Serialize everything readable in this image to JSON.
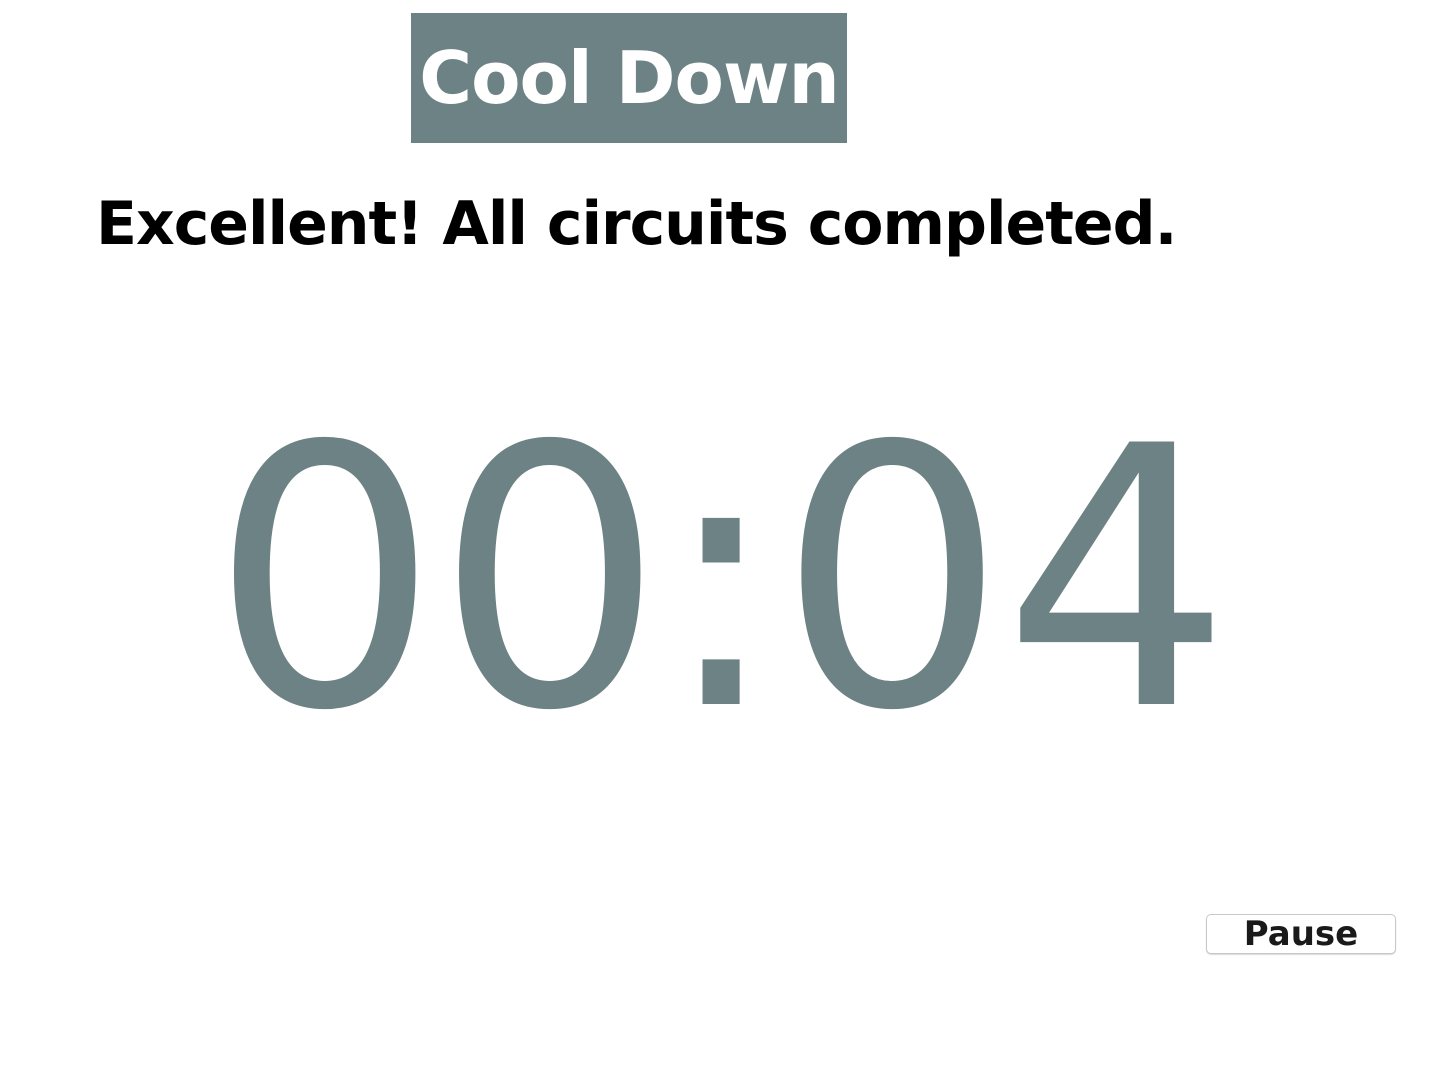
{
  "phase": {
    "title": "Cool Down",
    "color": "#6d8284"
  },
  "status": {
    "message": "Excellent! All circuits completed."
  },
  "timer": {
    "display": "00:04",
    "color": "#6d8284"
  },
  "controls": {
    "pause_label": "Pause"
  }
}
